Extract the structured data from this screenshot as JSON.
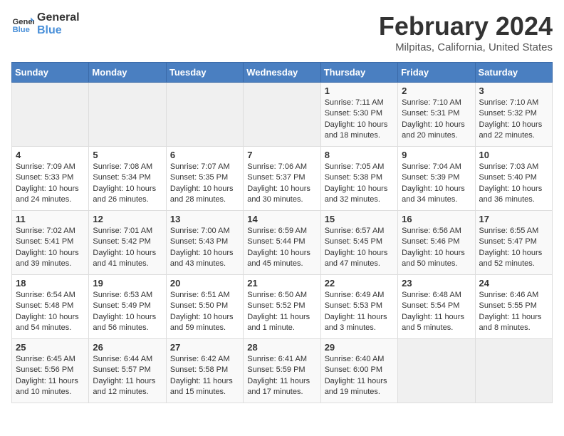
{
  "header": {
    "logo_line1": "General",
    "logo_line2": "Blue",
    "title": "February 2024",
    "subtitle": "Milpitas, California, United States"
  },
  "days_of_week": [
    "Sunday",
    "Monday",
    "Tuesday",
    "Wednesday",
    "Thursday",
    "Friday",
    "Saturday"
  ],
  "weeks": [
    [
      {
        "day": "",
        "info": ""
      },
      {
        "day": "",
        "info": ""
      },
      {
        "day": "",
        "info": ""
      },
      {
        "day": "",
        "info": ""
      },
      {
        "day": "1",
        "info": "Sunrise: 7:11 AM\nSunset: 5:30 PM\nDaylight: 10 hours\nand 18 minutes."
      },
      {
        "day": "2",
        "info": "Sunrise: 7:10 AM\nSunset: 5:31 PM\nDaylight: 10 hours\nand 20 minutes."
      },
      {
        "day": "3",
        "info": "Sunrise: 7:10 AM\nSunset: 5:32 PM\nDaylight: 10 hours\nand 22 minutes."
      }
    ],
    [
      {
        "day": "4",
        "info": "Sunrise: 7:09 AM\nSunset: 5:33 PM\nDaylight: 10 hours\nand 24 minutes."
      },
      {
        "day": "5",
        "info": "Sunrise: 7:08 AM\nSunset: 5:34 PM\nDaylight: 10 hours\nand 26 minutes."
      },
      {
        "day": "6",
        "info": "Sunrise: 7:07 AM\nSunset: 5:35 PM\nDaylight: 10 hours\nand 28 minutes."
      },
      {
        "day": "7",
        "info": "Sunrise: 7:06 AM\nSunset: 5:37 PM\nDaylight: 10 hours\nand 30 minutes."
      },
      {
        "day": "8",
        "info": "Sunrise: 7:05 AM\nSunset: 5:38 PM\nDaylight: 10 hours\nand 32 minutes."
      },
      {
        "day": "9",
        "info": "Sunrise: 7:04 AM\nSunset: 5:39 PM\nDaylight: 10 hours\nand 34 minutes."
      },
      {
        "day": "10",
        "info": "Sunrise: 7:03 AM\nSunset: 5:40 PM\nDaylight: 10 hours\nand 36 minutes."
      }
    ],
    [
      {
        "day": "11",
        "info": "Sunrise: 7:02 AM\nSunset: 5:41 PM\nDaylight: 10 hours\nand 39 minutes."
      },
      {
        "day": "12",
        "info": "Sunrise: 7:01 AM\nSunset: 5:42 PM\nDaylight: 10 hours\nand 41 minutes."
      },
      {
        "day": "13",
        "info": "Sunrise: 7:00 AM\nSunset: 5:43 PM\nDaylight: 10 hours\nand 43 minutes."
      },
      {
        "day": "14",
        "info": "Sunrise: 6:59 AM\nSunset: 5:44 PM\nDaylight: 10 hours\nand 45 minutes."
      },
      {
        "day": "15",
        "info": "Sunrise: 6:57 AM\nSunset: 5:45 PM\nDaylight: 10 hours\nand 47 minutes."
      },
      {
        "day": "16",
        "info": "Sunrise: 6:56 AM\nSunset: 5:46 PM\nDaylight: 10 hours\nand 50 minutes."
      },
      {
        "day": "17",
        "info": "Sunrise: 6:55 AM\nSunset: 5:47 PM\nDaylight: 10 hours\nand 52 minutes."
      }
    ],
    [
      {
        "day": "18",
        "info": "Sunrise: 6:54 AM\nSunset: 5:48 PM\nDaylight: 10 hours\nand 54 minutes."
      },
      {
        "day": "19",
        "info": "Sunrise: 6:53 AM\nSunset: 5:49 PM\nDaylight: 10 hours\nand 56 minutes."
      },
      {
        "day": "20",
        "info": "Sunrise: 6:51 AM\nSunset: 5:50 PM\nDaylight: 10 hours\nand 59 minutes."
      },
      {
        "day": "21",
        "info": "Sunrise: 6:50 AM\nSunset: 5:52 PM\nDaylight: 11 hours\nand 1 minute."
      },
      {
        "day": "22",
        "info": "Sunrise: 6:49 AM\nSunset: 5:53 PM\nDaylight: 11 hours\nand 3 minutes."
      },
      {
        "day": "23",
        "info": "Sunrise: 6:48 AM\nSunset: 5:54 PM\nDaylight: 11 hours\nand 5 minutes."
      },
      {
        "day": "24",
        "info": "Sunrise: 6:46 AM\nSunset: 5:55 PM\nDaylight: 11 hours\nand 8 minutes."
      }
    ],
    [
      {
        "day": "25",
        "info": "Sunrise: 6:45 AM\nSunset: 5:56 PM\nDaylight: 11 hours\nand 10 minutes."
      },
      {
        "day": "26",
        "info": "Sunrise: 6:44 AM\nSunset: 5:57 PM\nDaylight: 11 hours\nand 12 minutes."
      },
      {
        "day": "27",
        "info": "Sunrise: 6:42 AM\nSunset: 5:58 PM\nDaylight: 11 hours\nand 15 minutes."
      },
      {
        "day": "28",
        "info": "Sunrise: 6:41 AM\nSunset: 5:59 PM\nDaylight: 11 hours\nand 17 minutes."
      },
      {
        "day": "29",
        "info": "Sunrise: 6:40 AM\nSunset: 6:00 PM\nDaylight: 11 hours\nand 19 minutes."
      },
      {
        "day": "",
        "info": ""
      },
      {
        "day": "",
        "info": ""
      }
    ]
  ]
}
